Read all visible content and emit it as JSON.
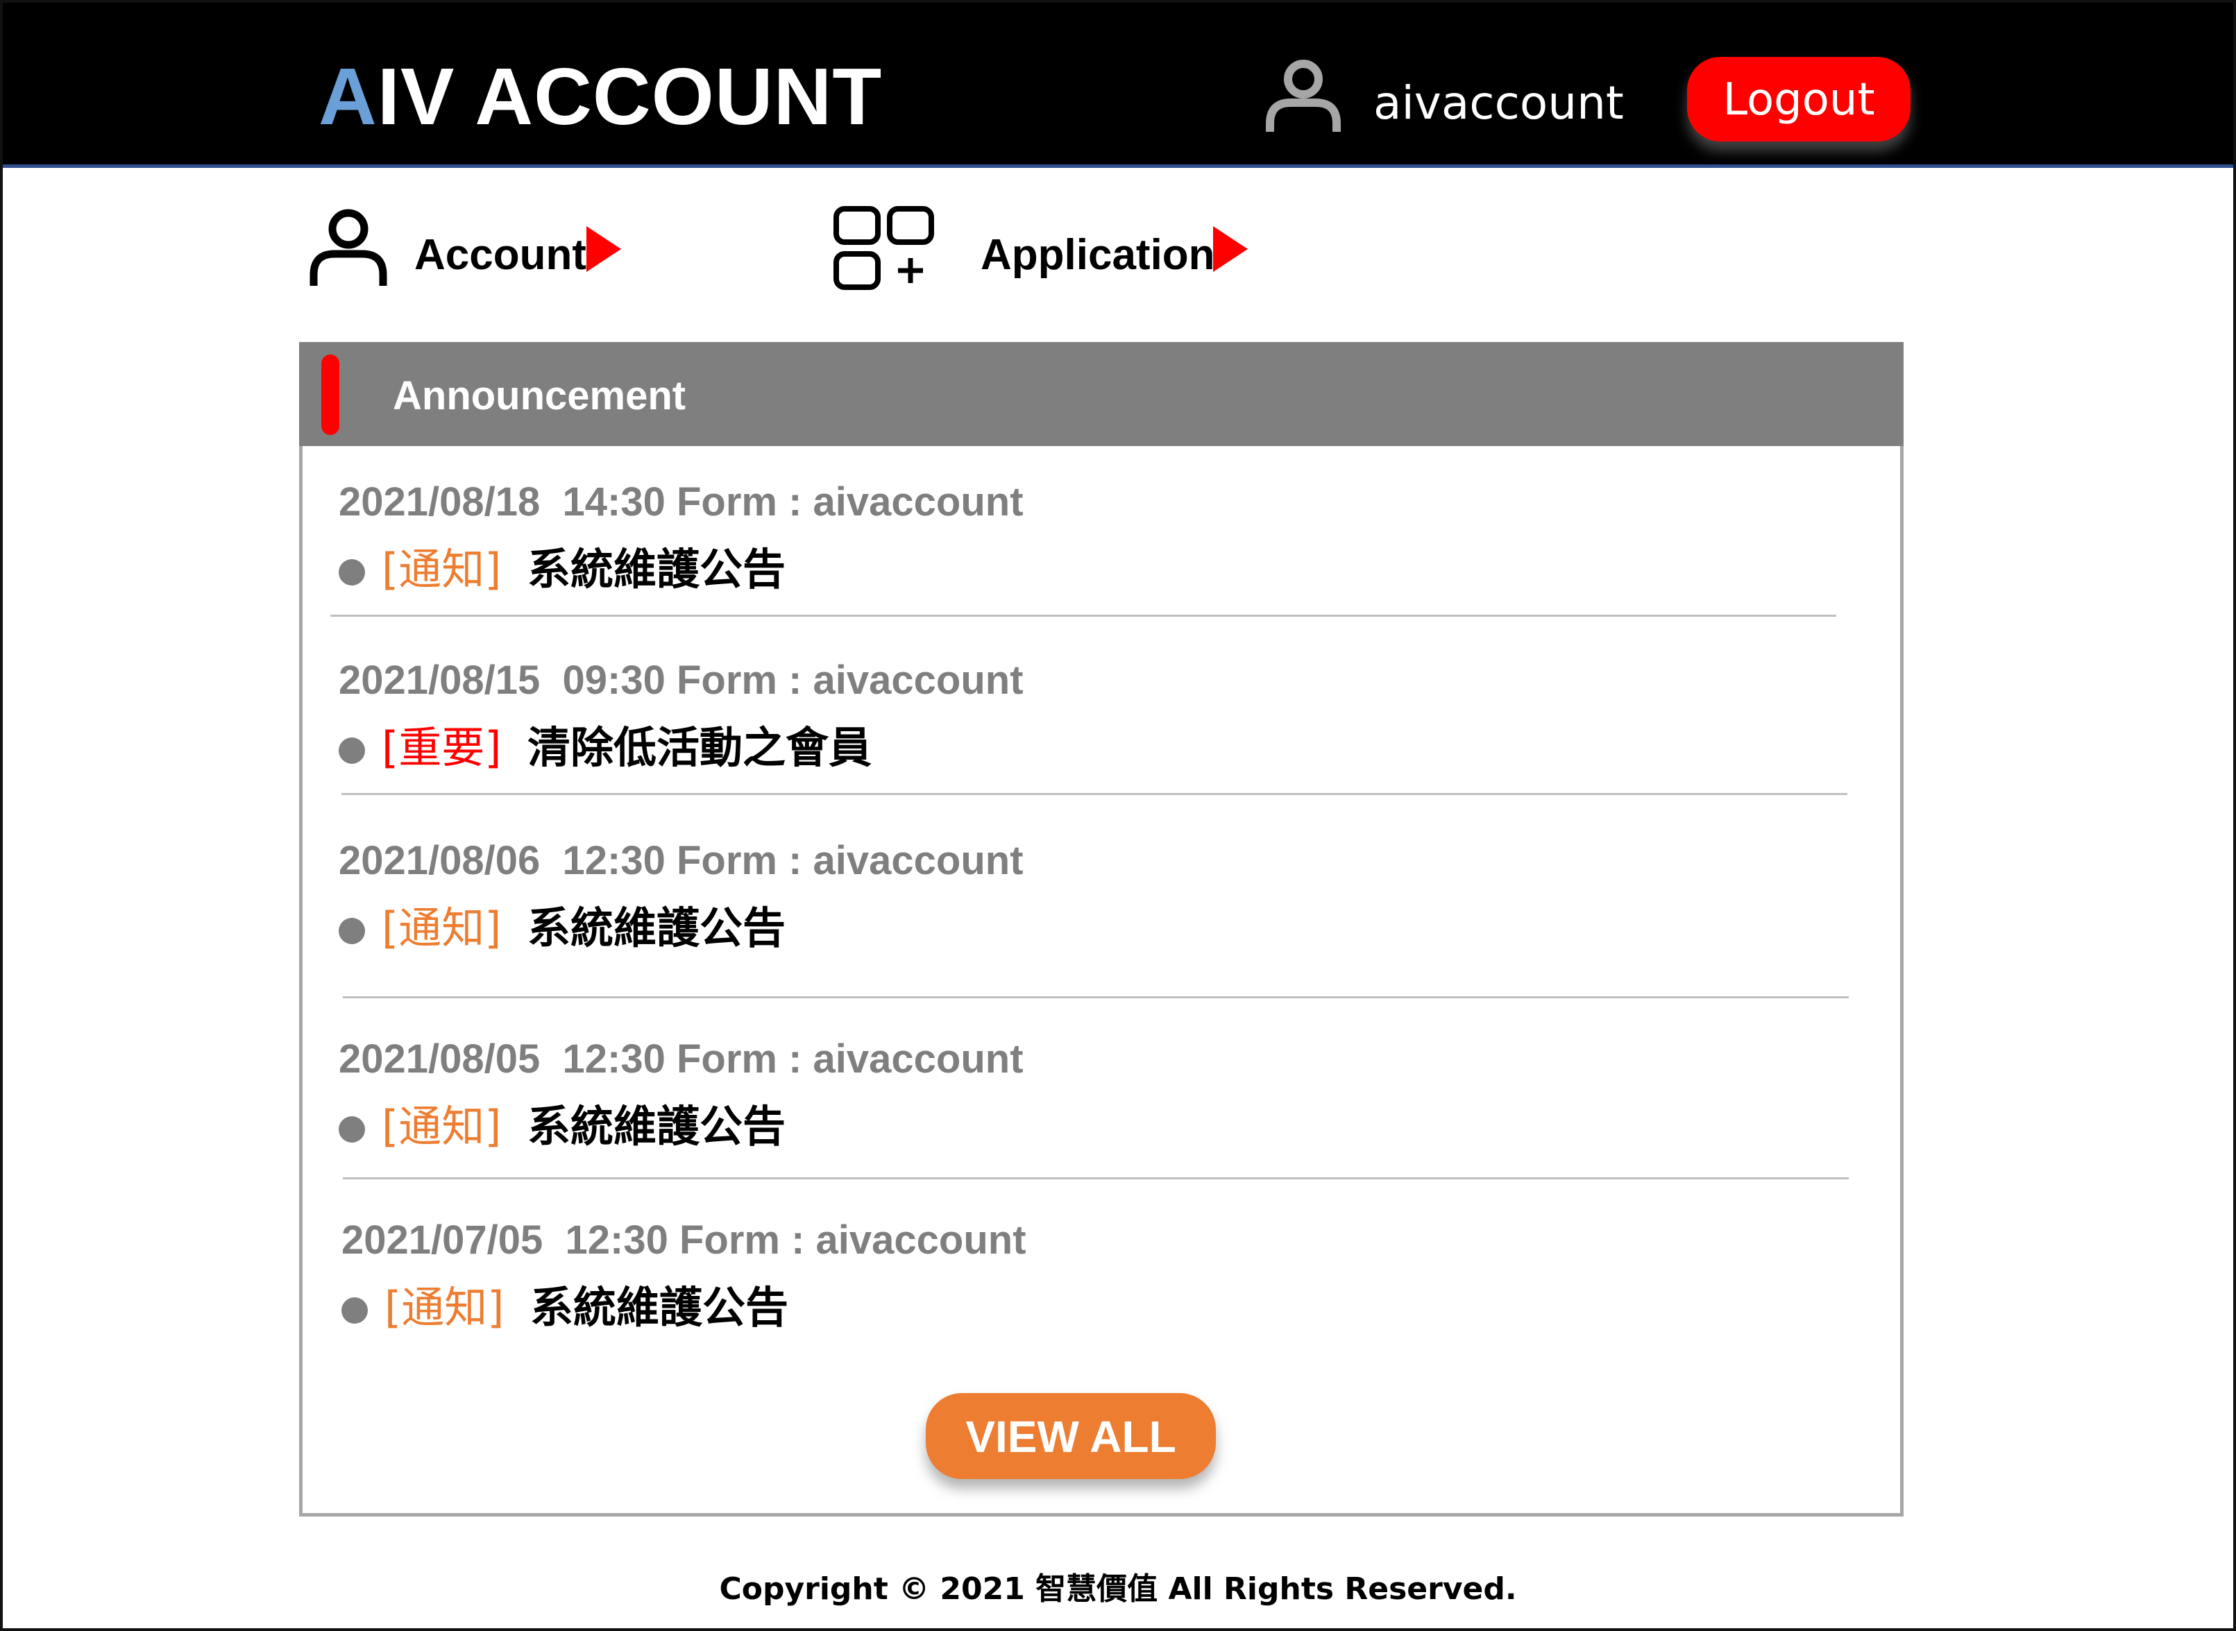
{
  "header": {
    "brand_accent": "A",
    "brand_rest": "IV ACCOUNT",
    "username": "aivaccount",
    "logout_label": "Logout",
    "user_icon": "user-icon"
  },
  "nav": {
    "account": {
      "label": "Account",
      "icon": "user-icon",
      "arrow": "play-arrow-icon"
    },
    "application": {
      "label": "Application",
      "icon": "apps-add-icon",
      "arrow": "play-arrow-icon"
    }
  },
  "announcement": {
    "title": "Announcement",
    "items": [
      {
        "meta": "2021/08/18  14:30 Form : aivaccount",
        "tag": "[通知]",
        "tag_type": "notice",
        "title": "系統維護公告"
      },
      {
        "meta": "2021/08/15  09:30 Form : aivaccount",
        "tag": "[重要]",
        "tag_type": "important",
        "title": "清除低活動之會員"
      },
      {
        "meta": "2021/08/06  12:30 Form : aivaccount",
        "tag": "[通知]",
        "tag_type": "notice",
        "title": "系統維護公告"
      },
      {
        "meta": "2021/08/05  12:30 Form : aivaccount",
        "tag": "[通知]",
        "tag_type": "notice",
        "title": "系統維護公告"
      },
      {
        "meta": "2021/07/05  12:30 Form : aivaccount",
        "tag": "[通知]",
        "tag_type": "notice",
        "title": "系統維護公告"
      }
    ],
    "view_all_label": "VIEW ALL"
  },
  "footer": {
    "text": "Copyright © 2021 智慧價值 All Rights Reserved."
  },
  "colors": {
    "header_bg": "#000000",
    "brand_accent": "#6a9fd8",
    "logout_bg": "#ff0000",
    "panel_header_bg": "#7f7f7f",
    "notice_tag": "#ed7d31",
    "important_tag": "#ff0000",
    "view_all_bg": "#ed7d31"
  }
}
